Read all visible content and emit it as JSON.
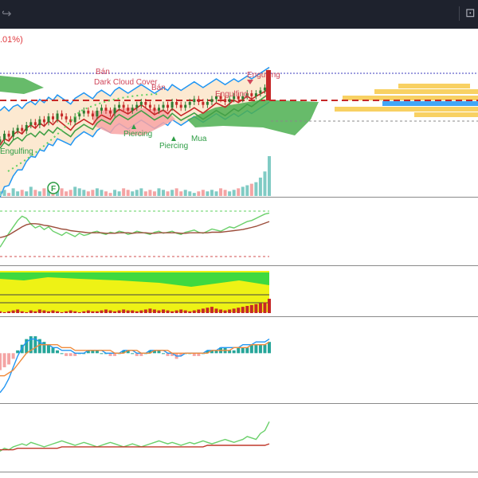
{
  "toolbar": {
    "redo_icon": "redo-icon",
    "camera_icon": "camera-icon"
  },
  "legend": {
    "change_text": ".01%)"
  },
  "colors": {
    "up": "#26a69a",
    "down": "#ef5350",
    "kumo_green": "#4caf50",
    "kumo_red": "#f8a5a5",
    "bb": "#2196f3",
    "bb_fill": "#fbe3c6",
    "signal_green": "#5fd05f",
    "signal_red": "#d05050"
  },
  "chart_data": [
    {
      "type": "candlestick",
      "pane": "main",
      "annotations": [
        {
          "text": "Bán",
          "kind": "sell"
        },
        {
          "text": "Bán",
          "kind": "sell"
        },
        {
          "text": "Dark Cloud Cover",
          "kind": "bearish-pattern"
        },
        {
          "text": "Engulfing",
          "kind": "bearish-pattern"
        },
        {
          "text": "Engulfing",
          "kind": "bearish-pattern"
        },
        {
          "text": "Engulfing",
          "kind": "bullish-pattern"
        },
        {
          "text": "Piercing",
          "kind": "bullish-pattern"
        },
        {
          "text": "Piercing",
          "kind": "bullish-pattern"
        },
        {
          "text": "Mua",
          "kind": "buy"
        }
      ],
      "close": [
        41,
        43,
        42,
        44,
        45,
        44,
        46,
        47,
        46,
        48,
        47,
        49,
        48,
        50,
        49,
        48,
        47,
        49,
        50,
        51,
        50,
        49,
        51,
        52,
        51,
        50,
        52,
        53,
        52,
        51,
        52,
        53,
        54,
        53,
        52,
        51,
        52,
        53,
        52,
        54,
        53,
        52,
        53,
        54,
        55,
        54,
        53,
        54,
        55,
        56,
        55,
        54,
        55,
        56,
        55,
        56,
        57,
        56,
        57,
        58,
        59,
        60
      ]
    },
    {
      "type": "volume",
      "pane": "main",
      "badge": "F",
      "values": [
        3,
        4,
        2,
        5,
        3,
        4,
        3,
        6,
        4,
        3,
        5,
        4,
        3,
        4,
        5,
        3,
        4,
        6,
        5,
        4,
        3,
        4,
        5,
        4,
        3,
        2,
        4,
        3,
        5,
        4,
        3,
        4,
        5,
        3,
        4,
        3,
        5,
        4,
        3,
        4,
        5,
        3,
        4,
        3,
        2,
        3,
        4,
        3,
        4,
        3,
        5,
        4,
        3,
        4,
        5,
        6,
        7,
        8,
        9,
        12,
        16,
        26
      ]
    },
    {
      "type": "line",
      "pane": "rsi",
      "series": [
        {
          "color": "green",
          "values": [
            22,
            35,
            48,
            60,
            72,
            80,
            76,
            65,
            58,
            62,
            55,
            60,
            52,
            48,
            44,
            50,
            46,
            42,
            48,
            44,
            46,
            50,
            52,
            48,
            46,
            50,
            48,
            52,
            50,
            46,
            48,
            52,
            50,
            48,
            46,
            50,
            52,
            48,
            50,
            52,
            48,
            46,
            50,
            52,
            54,
            50,
            48,
            52,
            56,
            54,
            52,
            56,
            60,
            58,
            62,
            66,
            70,
            72,
            76,
            80,
            84,
            86
          ]
        },
        {
          "color": "brown",
          "values": [
            40,
            42,
            45,
            50,
            55,
            60,
            64,
            66,
            66,
            65,
            63,
            62,
            60,
            58,
            56,
            55,
            53,
            52,
            51,
            50,
            49,
            49,
            49,
            49,
            48,
            48,
            48,
            49,
            49,
            49,
            48,
            49,
            49,
            49,
            48,
            48,
            49,
            49,
            49,
            49,
            49,
            48,
            48,
            49,
            49,
            49,
            49,
            49,
            50,
            50,
            50,
            51,
            52,
            53,
            54,
            55,
            57,
            59,
            61,
            64,
            67,
            70
          ]
        }
      ]
    },
    {
      "type": "histogram",
      "pane": "trend-bars",
      "values": [
        2,
        1,
        2,
        3,
        4,
        2,
        1,
        3,
        2,
        4,
        3,
        2,
        3,
        2,
        1,
        2,
        3,
        2,
        1,
        2,
        3,
        2,
        2,
        3,
        4,
        3,
        2,
        3,
        4,
        3,
        3,
        2,
        3,
        4,
        5,
        4,
        3,
        4,
        3,
        2,
        3,
        4,
        3,
        2,
        3,
        4,
        5,
        6,
        7,
        5,
        4,
        3,
        4,
        5,
        6,
        7,
        8,
        9,
        10,
        11,
        12,
        16
      ],
      "colors": [
        "red",
        "red",
        "red",
        "red",
        "red",
        "red",
        "red",
        "red",
        "red",
        "red",
        "red",
        "red",
        "red",
        "red",
        "red",
        "red",
        "red",
        "red",
        "red",
        "red",
        "red",
        "red",
        "red",
        "red",
        "red",
        "red",
        "red",
        "red",
        "red",
        "red",
        "red",
        "red",
        "red",
        "red",
        "red",
        "red",
        "red",
        "red",
        "red",
        "red",
        "red",
        "red",
        "red",
        "red",
        "red",
        "red",
        "red",
        "red",
        "red",
        "red",
        "red",
        "red",
        "red",
        "red",
        "red",
        "red",
        "red",
        "red",
        "red",
        "red",
        "red",
        "red"
      ]
    },
    {
      "type": "macd",
      "pane": "macd",
      "histogram": [
        -6,
        -5,
        -4,
        -2,
        1,
        3,
        5,
        6,
        6,
        5,
        4,
        3,
        2,
        1,
        0,
        -1,
        -1,
        -1,
        0,
        0,
        1,
        1,
        1,
        0,
        0,
        -1,
        -1,
        0,
        1,
        1,
        0,
        -1,
        -1,
        0,
        1,
        1,
        1,
        0,
        -1,
        -1,
        -2,
        -1,
        0,
        0,
        -1,
        -1,
        0,
        1,
        1,
        1,
        2,
        2,
        1,
        1,
        2,
        2,
        2,
        3,
        3,
        3,
        3,
        4
      ],
      "macd": [
        -14,
        -12,
        -9,
        -5,
        -1,
        2,
        4,
        5,
        5,
        4,
        3,
        3,
        2,
        2,
        1,
        1,
        1,
        0,
        0,
        0,
        1,
        1,
        1,
        1,
        0,
        0,
        0,
        0,
        1,
        1,
        1,
        0,
        0,
        0,
        1,
        1,
        1,
        1,
        0,
        0,
        -1,
        -1,
        0,
        0,
        0,
        0,
        0,
        1,
        1,
        1,
        2,
        2,
        2,
        2,
        2,
        3,
        3,
        3,
        4,
        4,
        4,
        5
      ],
      "signal": [
        -8,
        -8,
        -7,
        -6,
        -4,
        -2,
        0,
        1,
        2,
        3,
        3,
        3,
        3,
        3,
        2,
        2,
        2,
        1,
        1,
        1,
        1,
        1,
        1,
        1,
        1,
        1,
        0,
        0,
        0,
        1,
        1,
        1,
        0,
        0,
        0,
        1,
        1,
        1,
        1,
        0,
        0,
        0,
        0,
        0,
        0,
        0,
        0,
        0,
        1,
        1,
        1,
        1,
        1,
        2,
        2,
        2,
        2,
        3,
        3,
        3,
        3,
        4
      ]
    },
    {
      "type": "line",
      "pane": "bottom-osc",
      "series": [
        {
          "color": "green",
          "values": [
            50,
            52,
            51,
            53,
            54,
            55,
            54,
            56,
            55,
            54,
            53,
            54,
            55,
            56,
            57,
            56,
            55,
            54,
            55,
            56,
            55,
            54,
            53,
            54,
            55,
            56,
            55,
            54,
            53,
            54,
            55,
            54,
            53,
            54,
            55,
            56,
            57,
            56,
            55,
            56,
            55,
            54,
            55,
            56,
            55,
            56,
            57,
            56,
            55,
            56,
            57,
            58,
            57,
            56,
            57,
            58,
            60,
            59,
            58,
            62,
            64,
            70
          ]
        },
        {
          "color": "brown",
          "values": [
            51,
            51,
            51,
            51,
            52,
            52,
            52,
            52,
            52,
            52,
            52,
            52,
            52,
            52,
            53,
            53,
            53,
            53,
            53,
            53,
            53,
            53,
            53,
            53,
            53,
            53,
            53,
            53,
            53,
            53,
            53,
            53,
            53,
            53,
            53,
            53,
            53,
            53,
            53,
            53,
            53,
            53,
            53,
            53,
            53,
            53,
            53,
            54,
            54,
            54,
            54,
            54,
            54,
            54,
            54,
            54,
            54,
            54,
            54,
            54,
            54,
            55
          ]
        }
      ]
    }
  ]
}
